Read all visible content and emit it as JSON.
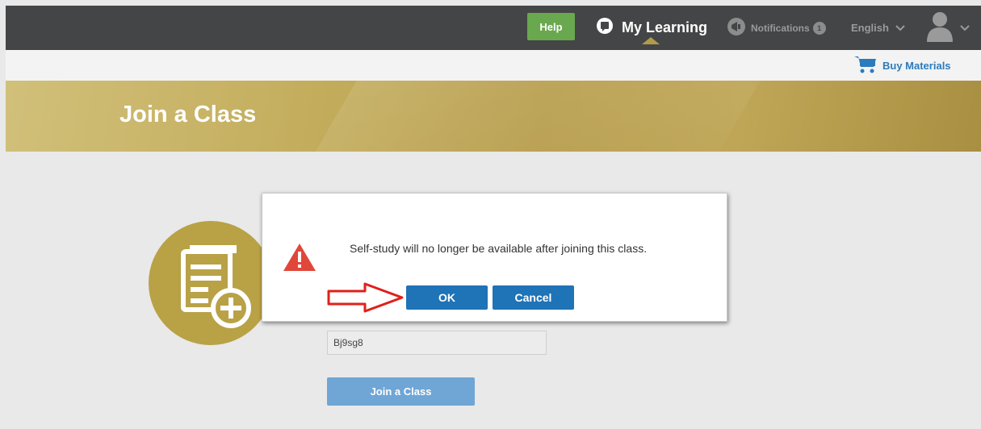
{
  "header": {
    "help_label": "Help",
    "my_learning_label": "My Learning",
    "notifications_label": "Notifications",
    "notifications_count": "1",
    "language_label": "English"
  },
  "subheader": {
    "buy_materials_label": "Buy Materials"
  },
  "banner": {
    "title": "Join a Class"
  },
  "form": {
    "class_code_value": "Bj9sg8",
    "join_button_label": "Join a Class"
  },
  "dialog": {
    "message": "Self-study will no longer be available after joining this class.",
    "ok_label": "OK",
    "cancel_label": "Cancel"
  },
  "colors": {
    "topbar": "#444546",
    "help_green": "#6aa84f",
    "banner_gold": "#b79d4c",
    "primary_blue": "#1f73b7",
    "warning_red": "#e0473a",
    "annotation_red": "#e0201a"
  },
  "icons": {
    "my_learning": "book-bubble-icon",
    "notifications": "megaphone-icon",
    "language": "chevron-down-icon",
    "user": "user-avatar-icon",
    "buy": "cart-icon",
    "warning": "warning-triangle-icon",
    "class": "document-add-icon"
  }
}
